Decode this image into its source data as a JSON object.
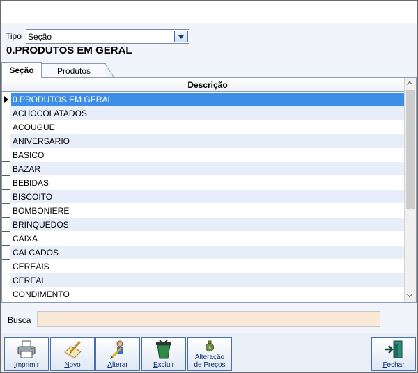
{
  "tipo": {
    "label_u": "T",
    "label_rest": "ipo",
    "value": "Seção"
  },
  "heading": "0.PRODUTOS EM GERAL",
  "tabs": {
    "secao": "Seção",
    "produtos": "Produtos"
  },
  "grid": {
    "column": "Descrição",
    "rows": [
      "0.PRODUTOS EM GERAL",
      "ACHOCOLATADOS",
      "ACOUGUE",
      "ANIVERSARIO",
      "BASICO",
      "BAZAR",
      "BEBIDAS",
      "BISCOITO",
      "BOMBONIERE",
      "BRINQUEDOS",
      "CAIXA",
      "CALCADOS",
      "CEREAIS",
      "CEREAL",
      "CONDIMENTO"
    ]
  },
  "busca": {
    "label_u": "B",
    "label_rest": "usca",
    "value": ""
  },
  "toolbar": {
    "imprimir_u": "I",
    "imprimir_rest": "mprimir",
    "novo_u": "N",
    "novo_rest": "ovo",
    "alterar_u": "A",
    "alterar_rest": "lterar",
    "excluir_u": "E",
    "excluir_rest": "xcluir",
    "alteracao_line1": "Alteração",
    "alteracao_line2": "de Preços",
    "fechar_u": "F",
    "fechar_rest": "echar"
  },
  "colors": {
    "selection": "#3d8ee6",
    "row_alt": "#e8eef9",
    "search_bg": "#fbe9d7"
  },
  "icons": [
    "dropdown-arrow-icon",
    "printer-icon",
    "new-document-icon",
    "edit-pencil-icon",
    "trash-can-icon",
    "price-bag-icon",
    "exit-door-icon"
  ]
}
